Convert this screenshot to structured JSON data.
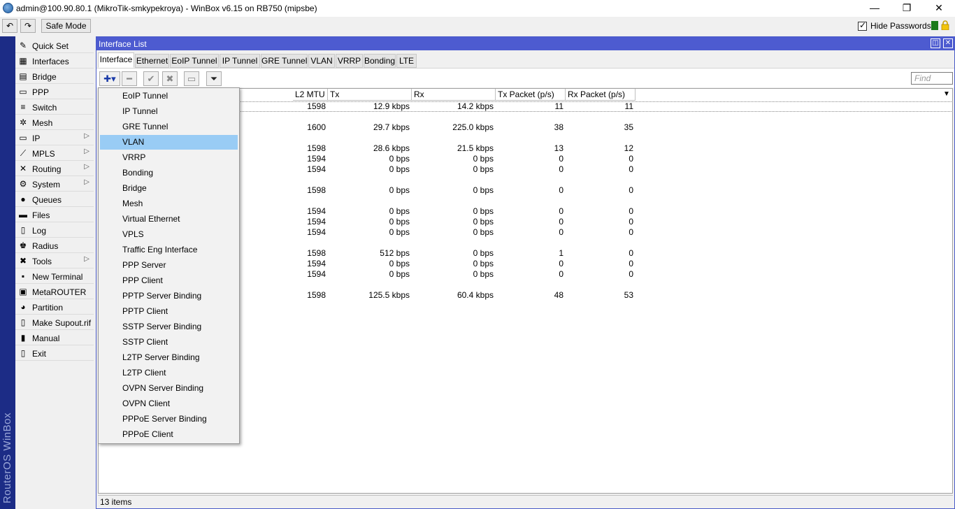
{
  "window": {
    "title": "admin@100.90.80.1 (MikroTik-smkypekroya) - WinBox v6.15 on RB750 (mipsbe)",
    "minimize": "—",
    "maximize": "❐",
    "close": "✕"
  },
  "toolbar": {
    "undo_icon": "↶",
    "redo_icon": "↷",
    "safe_mode": "Safe Mode",
    "hide_passwords": "Hide Passwords",
    "hide_passwords_checked": true
  },
  "brand": "RouterOS WinBox",
  "sidemenu": [
    {
      "label": "Quick Set",
      "icon": "quick-set-icon",
      "glyph": "✎",
      "submenu": false
    },
    {
      "label": "Interfaces",
      "icon": "interfaces-icon",
      "glyph": "▦",
      "submenu": false
    },
    {
      "label": "Bridge",
      "icon": "bridge-icon",
      "glyph": "▤",
      "submenu": false
    },
    {
      "label": "PPP",
      "icon": "ppp-icon",
      "glyph": "▭",
      "submenu": false
    },
    {
      "label": "Switch",
      "icon": "switch-icon",
      "glyph": "≡",
      "submenu": false
    },
    {
      "label": "Mesh",
      "icon": "mesh-icon",
      "glyph": "✲",
      "submenu": false
    },
    {
      "label": "IP",
      "icon": "ip-icon",
      "glyph": "▭",
      "submenu": true
    },
    {
      "label": "MPLS",
      "icon": "mpls-icon",
      "glyph": "⟋",
      "submenu": true
    },
    {
      "label": "Routing",
      "icon": "routing-icon",
      "glyph": "✕",
      "submenu": true
    },
    {
      "label": "System",
      "icon": "system-icon",
      "glyph": "⚙",
      "submenu": true
    },
    {
      "label": "Queues",
      "icon": "queues-icon",
      "glyph": "●",
      "submenu": false
    },
    {
      "label": "Files",
      "icon": "files-icon",
      "glyph": "▬",
      "submenu": false
    },
    {
      "label": "Log",
      "icon": "log-icon",
      "glyph": "▯",
      "submenu": false
    },
    {
      "label": "Radius",
      "icon": "radius-icon",
      "glyph": "♚",
      "submenu": false
    },
    {
      "label": "Tools",
      "icon": "tools-icon",
      "glyph": "✖",
      "submenu": true
    },
    {
      "label": "New Terminal",
      "icon": "terminal-icon",
      "glyph": "▪",
      "submenu": false
    },
    {
      "label": "MetaROUTER",
      "icon": "metarouter-icon",
      "glyph": "▣",
      "submenu": false
    },
    {
      "label": "Partition",
      "icon": "partition-icon",
      "glyph": "◕",
      "submenu": false
    },
    {
      "label": "Make Supout.rif",
      "icon": "supout-icon",
      "glyph": "▯",
      "submenu": false
    },
    {
      "label": "Manual",
      "icon": "manual-icon",
      "glyph": "▮",
      "submenu": false
    },
    {
      "label": "Exit",
      "icon": "exit-icon",
      "glyph": "▯",
      "submenu": false
    }
  ],
  "interface_window": {
    "title": "Interface List",
    "restore": "◫",
    "close": "✕",
    "tabs": [
      "Interface",
      "Ethernet",
      "EoIP Tunnel",
      "IP Tunnel",
      "GRE Tunnel",
      "VLAN",
      "VRRP",
      "Bonding",
      "LTE"
    ],
    "active_tab": "Interface",
    "tool_icons": {
      "add": "✚▾",
      "remove": "━",
      "enable": "✔",
      "disable": "✖",
      "comment": "▭",
      "filter": "⏷"
    },
    "find_placeholder": "Find",
    "columns": [
      "L2 MTU",
      "Tx",
      "Rx",
      "Tx Packet (p/s)",
      "Rx Packet (p/s)"
    ],
    "column_menu": "▼",
    "rows": [
      {
        "l2mtu": "1598",
        "tx": "12.9 kbps",
        "rx": "14.2 kbps",
        "txp": "11",
        "rxp": "11"
      },
      null,
      {
        "l2mtu": "1600",
        "tx": "29.7 kbps",
        "rx": "225.0 kbps",
        "txp": "38",
        "rxp": "35"
      },
      null,
      {
        "l2mtu": "1598",
        "tx": "28.6 kbps",
        "rx": "21.5 kbps",
        "txp": "13",
        "rxp": "12"
      },
      {
        "l2mtu": "1594",
        "tx": "0 bps",
        "rx": "0 bps",
        "txp": "0",
        "rxp": "0"
      },
      {
        "l2mtu": "1594",
        "tx": "0 bps",
        "rx": "0 bps",
        "txp": "0",
        "rxp": "0"
      },
      null,
      {
        "l2mtu": "1598",
        "tx": "0 bps",
        "rx": "0 bps",
        "txp": "0",
        "rxp": "0"
      },
      null,
      {
        "l2mtu": "1594",
        "tx": "0 bps",
        "rx": "0 bps",
        "txp": "0",
        "rxp": "0"
      },
      {
        "l2mtu": "1594",
        "tx": "0 bps",
        "rx": "0 bps",
        "txp": "0",
        "rxp": "0"
      },
      {
        "l2mtu": "1594",
        "tx": "0 bps",
        "rx": "0 bps",
        "txp": "0",
        "rxp": "0"
      },
      null,
      {
        "l2mtu": "1598",
        "tx": "512 bps",
        "rx": "0 bps",
        "txp": "1",
        "rxp": "0"
      },
      {
        "l2mtu": "1594",
        "tx": "0 bps",
        "rx": "0 bps",
        "txp": "0",
        "rxp": "0"
      },
      {
        "l2mtu": "1594",
        "tx": "0 bps",
        "rx": "0 bps",
        "txp": "0",
        "rxp": "0"
      },
      null,
      {
        "l2mtu": "1598",
        "tx": "125.5 kbps",
        "rx": "60.4 kbps",
        "txp": "48",
        "rxp": "53"
      }
    ],
    "status": "13 items"
  },
  "add_menu": {
    "items": [
      "EoIP Tunnel",
      "IP Tunnel",
      "GRE Tunnel",
      "VLAN",
      "VRRP",
      "Bonding",
      "Bridge",
      "Mesh",
      "Virtual Ethernet",
      "VPLS",
      "Traffic Eng Interface",
      "PPP Server",
      "PPP Client",
      "PPTP Server Binding",
      "PPTP Client",
      "SSTP Server Binding",
      "SSTP Client",
      "L2TP Server Binding",
      "L2TP Client",
      "OVPN Server Binding",
      "OVPN Client",
      "PPPoE Server Binding",
      "PPPoE Client"
    ],
    "highlighted": "VLAN"
  },
  "colors": {
    "accent": "#4d5bd0",
    "strip": "#1c2c86",
    "highlight": "#99ccf5"
  }
}
